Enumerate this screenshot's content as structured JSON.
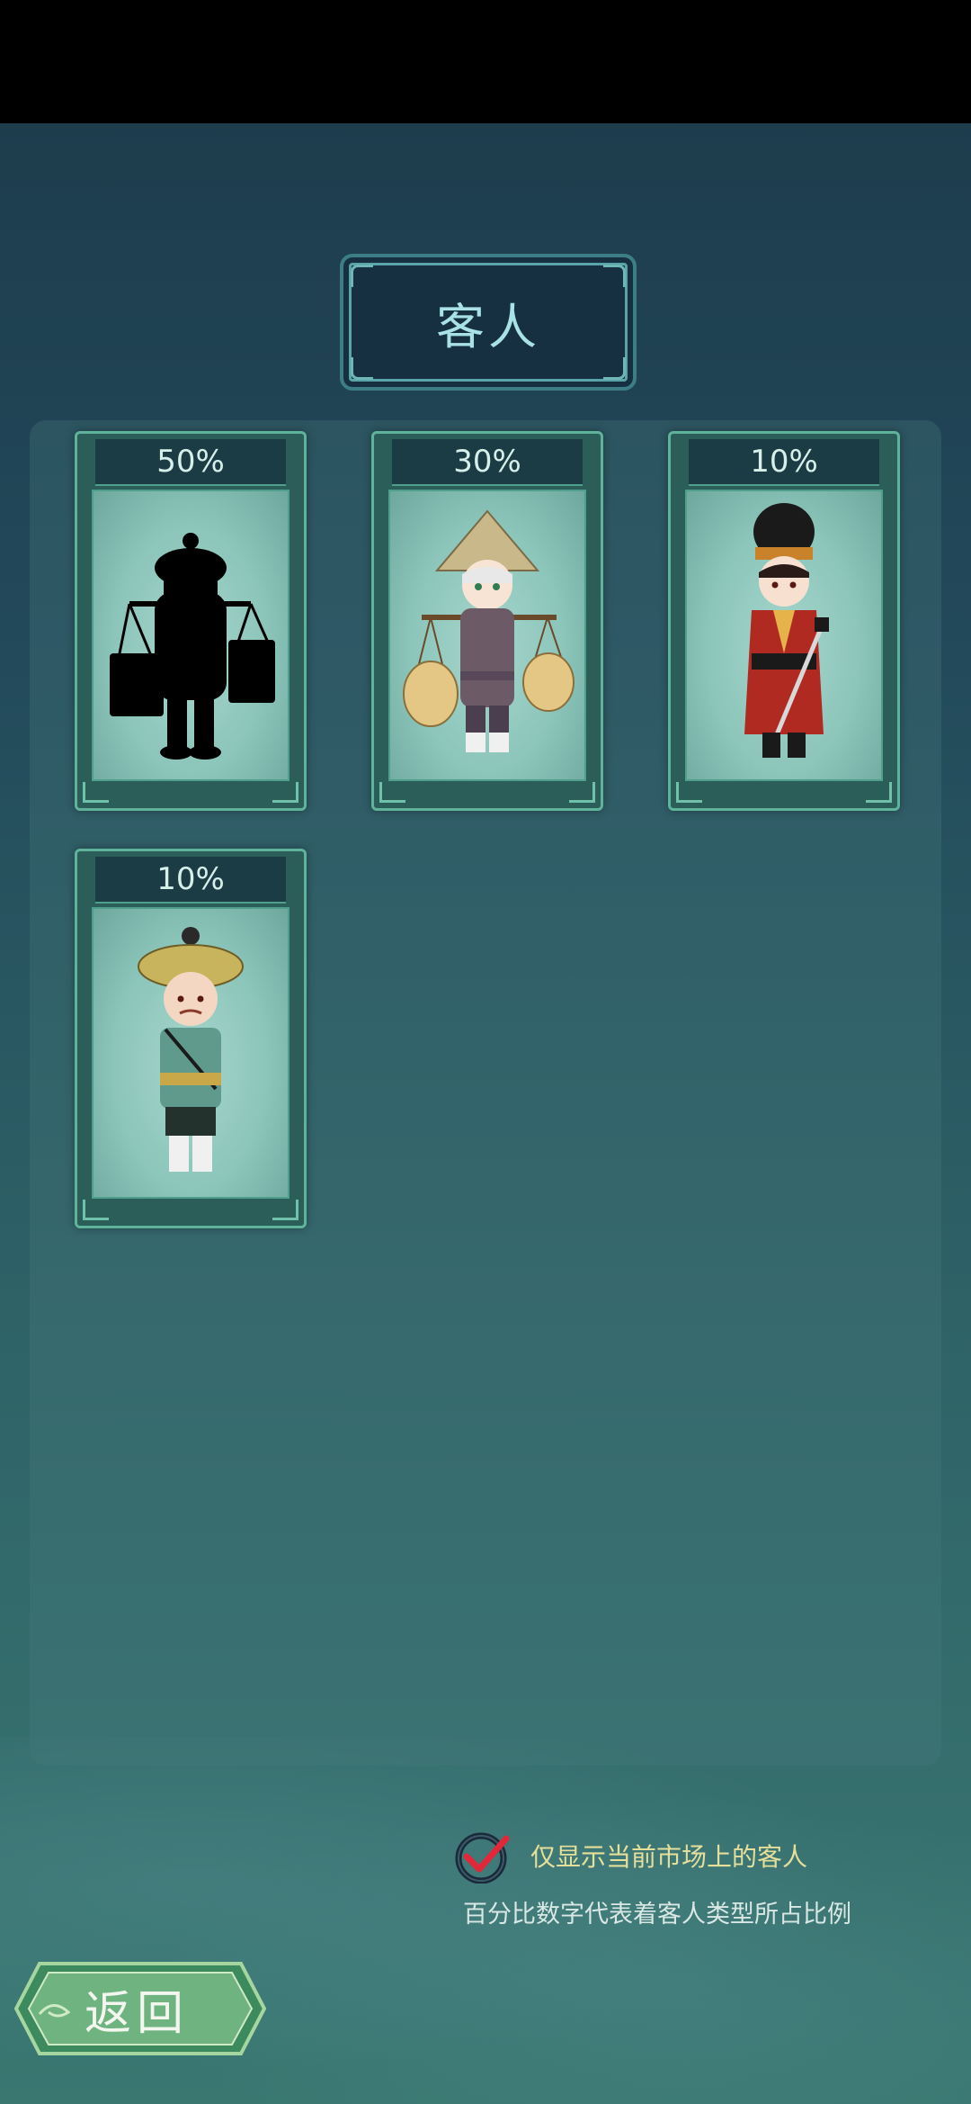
{
  "header": {
    "title": "客人"
  },
  "guests": [
    {
      "percent": "50%",
      "icon": "locked-guest-silhouette-icon"
    },
    {
      "percent": "30%",
      "icon": "farmer-with-carrying-pole-icon"
    },
    {
      "percent": "10%",
      "icon": "red-robed-swordsman-icon"
    },
    {
      "percent": "10%",
      "icon": "straw-hat-laborer-icon"
    }
  ],
  "footer": {
    "filter_checked": true,
    "filter_label": "仅显示当前市场上的客人",
    "percent_note": "百分比数字代表着客人类型所占比例"
  },
  "back_button": {
    "label": "返回"
  },
  "colors": {
    "accent": "#5fb39a",
    "title_text": "#a9e2e6",
    "note_text": "#e6df9a",
    "check_mark": "#e0283a"
  }
}
